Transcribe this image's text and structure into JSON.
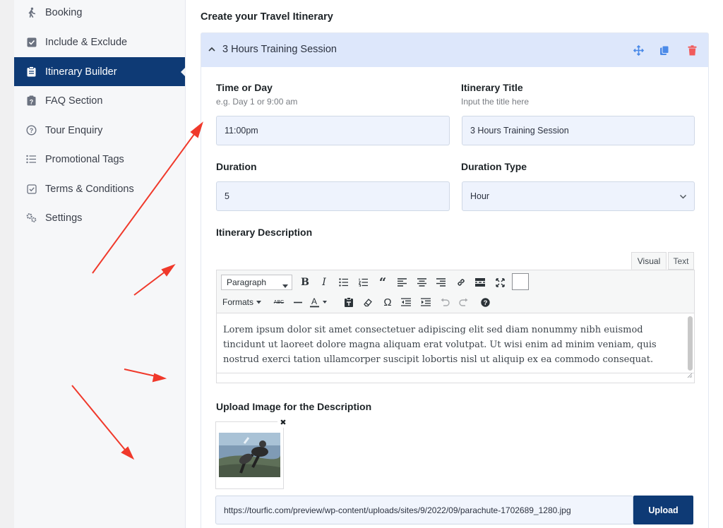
{
  "sidebar": {
    "items": [
      {
        "label": "Booking",
        "icon": "person-walking-icon"
      },
      {
        "label": "Include & Exclude",
        "icon": "checkbox-icon"
      },
      {
        "label": "Itinerary Builder",
        "icon": "clipboard-icon",
        "active": true
      },
      {
        "label": "FAQ Section",
        "icon": "question-clipboard-icon"
      },
      {
        "label": "Tour Enquiry",
        "icon": "question-circle-icon"
      },
      {
        "label": "Promotional Tags",
        "icon": "list-icon"
      },
      {
        "label": "Terms & Conditions",
        "icon": "check-square-icon"
      },
      {
        "label": "Settings",
        "icon": "gears-icon"
      }
    ],
    "active_bg": "#0e3a75"
  },
  "main": {
    "title": "Create your Travel Itinerary",
    "itinerary": {
      "header_title": "3 Hours Training Session",
      "header_bg": "#dde7fb",
      "time_label": "Time or Day",
      "time_hint": "e.g. Day 1 or 9:00 am",
      "time_value": "11:00pm",
      "title_label": "Itinerary Title",
      "title_hint": "Input the title here",
      "title_value": "3 Hours Training Session",
      "duration_label": "Duration",
      "duration_value": "5",
      "duration_type_label": "Duration Type",
      "duration_type_value": "Hour",
      "description_label": "Itinerary Description",
      "editor": {
        "tab_visual": "Visual",
        "tab_text": "Text",
        "format_select": "Paragraph",
        "formats_menu": "Formats",
        "content": "Lorem ipsum dolor sit amet consectetuer adipiscing elit sed diam nonummy nibh euismod tincidunt ut laoreet dolore magna aliquam erat volutpat. Ut wisi enim ad minim veniam, quis nostrud exerci tation ullamcorper suscipit lobortis nisl ut aliquip ex ea commodo consequat."
      },
      "upload_label": "Upload Image for the Description",
      "image_url": "https://tourfic.com/preview/wp-content/uploads/sites/9/2022/09/parachute-1702689_1280.jpg",
      "upload_button": "Upload",
      "upload_bg": "#0e3a75"
    }
  },
  "annotation_color": "#f0392b"
}
